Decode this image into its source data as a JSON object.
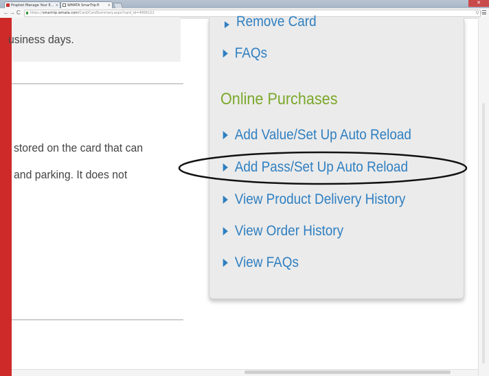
{
  "browser": {
    "tabs": [
      {
        "label": "Prophet Manage Your E...",
        "active": false
      },
      {
        "label": "WMATA SmarTrip®",
        "active": true
      }
    ],
    "close_glyph": "×",
    "window_close_glyph": "✕",
    "nav": {
      "back": "←",
      "forward": "→",
      "reload": "C"
    },
    "url_scheme": "https://",
    "url_host": "smartrip.wmata.com",
    "url_path": "/Card/CardSummary.aspx?card_id=4956122",
    "zoom_indicator": "Q ☆"
  },
  "left_content": {
    "business_days_text": "usiness days.",
    "description_line1": "stored on the card that can",
    "description_line2": "and parking. It does not"
  },
  "sidebar": {
    "cut_off_link": "Remove Card",
    "faqs_link": "FAQs",
    "online_purchases_heading": "Online Purchases",
    "links": [
      "Add Value/Set Up Auto Reload",
      "Add Pass/Set Up Auto Reload",
      "View Product Delivery History",
      "View Order History",
      "View FAQs"
    ]
  },
  "colors": {
    "link": "#2f7fc1",
    "heading": "#7ba82b",
    "brand_red": "#cf2a2a",
    "panel_bg": "#ebebeb"
  },
  "annotation": {
    "type": "hand-drawn ellipse",
    "highlighted_link": "Add Pass/Set Up Auto Reload"
  }
}
